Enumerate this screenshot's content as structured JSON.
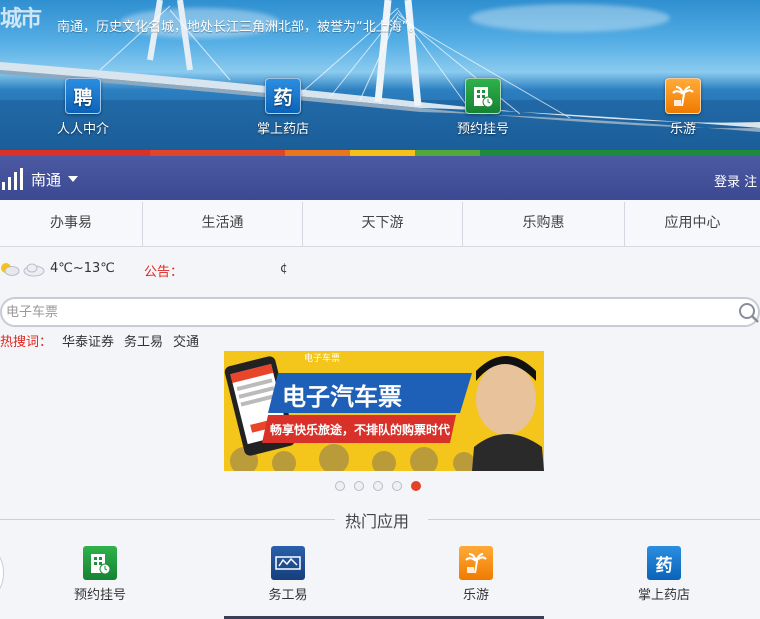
{
  "header": {
    "city_logo_text": "城市",
    "description": "南通，历史文化名城，地处长江三角洲北部，被誉为“北上海”。",
    "featured_apps": [
      {
        "label": "人人中介",
        "icon": "ren-agency-icon",
        "glyph": "聘",
        "color": "blue"
      },
      {
        "label": "掌上药店",
        "icon": "pharmacy-icon",
        "glyph": "药",
        "color": "blue"
      },
      {
        "label": "预约挂号",
        "icon": "hospital-appointment-icon",
        "glyph": "",
        "color": "green"
      },
      {
        "label": "乐游",
        "icon": "travel-palm-icon",
        "glyph": "",
        "color": "orange"
      }
    ],
    "strip_colors": [
      "#d8312a",
      "#e8761e",
      "#f6c219",
      "#52a83c",
      "#1e8a3c"
    ]
  },
  "citybar": {
    "city": "南通",
    "login": "登录 注"
  },
  "nav": {
    "items": [
      "办事易",
      "生活通",
      "天下游",
      "乐购惠",
      "应用中心"
    ]
  },
  "weather": {
    "temperature": "4℃~13℃",
    "notice_label": "公告：",
    "notice_text": "¢"
  },
  "search": {
    "placeholder": "电子车票"
  },
  "hot_search": {
    "label": "热搜词：",
    "words": [
      "华泰证券",
      "务工易",
      "交通"
    ]
  },
  "banner": {
    "title": "电子汽车票",
    "subtitle": "畅享快乐旅途，不排队的购票时代",
    "phone_caption": "电子车票"
  },
  "carousel": {
    "count": 5,
    "active_index": 4
  },
  "hot_apps": {
    "title": "热门应用",
    "items": [
      {
        "label": "预约挂号",
        "icon": "hospital-appointment-icon"
      },
      {
        "label": "务工易",
        "icon": "work-easy-icon"
      },
      {
        "label": "乐游",
        "icon": "travel-palm-icon"
      },
      {
        "label": "掌上药店",
        "icon": "pharmacy-icon"
      }
    ]
  },
  "colors": {
    "citybar": "#4452a0",
    "accent_red": "#e0261c"
  }
}
